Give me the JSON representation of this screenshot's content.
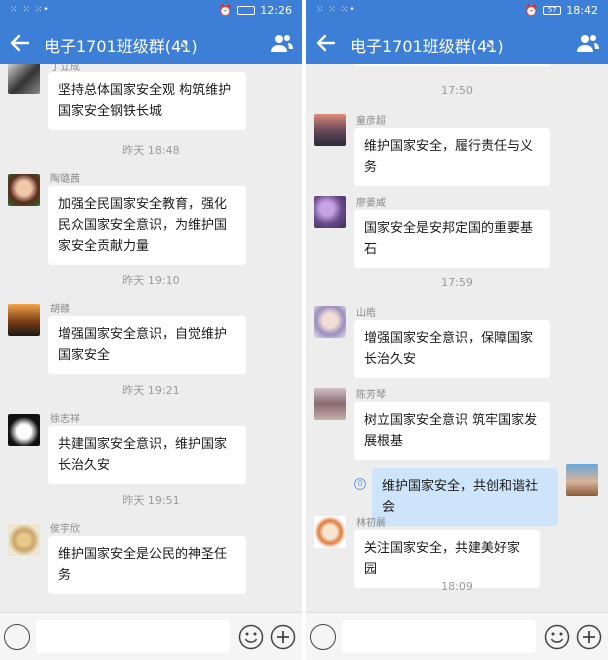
{
  "colors": {
    "brand": "#3d7fd6",
    "chat_bg": "#ededed",
    "bubble_other": "#ffffff",
    "bubble_self": "#cde4fb"
  },
  "left": {
    "status": {
      "signal": "⁙ ⁙ ⁙•",
      "time": "12:26"
    },
    "title": "电子1701班级群(41)",
    "messages": [
      {
        "name": "丁立成",
        "text": "坚持总体国家安全观 构筑维护国家安全钢铁长城"
      },
      {
        "time": "昨天  18:48"
      },
      {
        "name": "陶璐茜",
        "text": "加强全民国家安全教育，强化民众国家安全意识，为维护国家安全贡献力量"
      },
      {
        "time": "昨天  19:10"
      },
      {
        "name": "胡赣",
        "text": "增强国家安全意识，自觉维护国家安全"
      },
      {
        "time": "昨天  19:21"
      },
      {
        "name": "徐志祥",
        "text": "共建国家安全意识，维护国家长治久安"
      },
      {
        "time": "昨天  19:51"
      },
      {
        "name": "侯宇欣",
        "text": "维护国家安全是公民的神圣任务"
      }
    ]
  },
  "right": {
    "status": {
      "signal": "⁙ ⁙ ⁙•",
      "battery": "57",
      "time": "18:42"
    },
    "title": "电子1701班级群(41)",
    "messages": [
      {
        "time": "17:50"
      },
      {
        "name": "童彦超",
        "text": "维护国家安全，履行责任与义务"
      },
      {
        "name": "廖姜威",
        "text": "国家安全是安邦定国的重要基石"
      },
      {
        "time": "17:59"
      },
      {
        "name": "山皓",
        "text": "增强国家安全意识，保障国家长治久安"
      },
      {
        "name": "陈芳琴",
        "text": "树立国家安全意识 筑牢国家发展根基"
      },
      {
        "self": true,
        "read_count": "0",
        "text": "维护国家安全，共创和谐社会"
      },
      {
        "name": "林初晨",
        "text": "关注国家安全，共建美好家园"
      },
      {
        "time": "18:09"
      }
    ]
  }
}
